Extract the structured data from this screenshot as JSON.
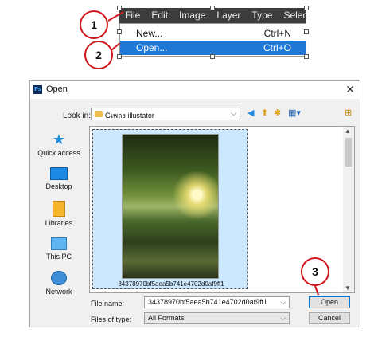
{
  "menubar": {
    "items": [
      "File",
      "Edit",
      "Image",
      "Layer",
      "Type",
      "Select"
    ]
  },
  "file_menu": {
    "new_label": "New...",
    "new_shortcut": "Ctrl+N",
    "open_label": "Open...",
    "open_shortcut": "Ctrl+O"
  },
  "steps": [
    "1",
    "2",
    "3"
  ],
  "dialog": {
    "app_badge": "Ps",
    "title": "Open",
    "close_glyph": "✕",
    "look_in_label": "Look in:",
    "look_in_value": "Ġเพลง illustator",
    "places": [
      "Quick access",
      "Desktop",
      "Libraries",
      "This PC",
      "Network"
    ],
    "file_item_name": "34378970bf5aea5b741e4702d0af9ff1",
    "file_name_label": "File name:",
    "file_name_value": "34378970bf5aea5b741e4702d0af9ff1",
    "file_type_label": "Files of type:",
    "file_type_value": "All Formats",
    "open_button": "Open",
    "cancel_button": "Cancel"
  },
  "colors": {
    "menu_bg": "#3c3c3c",
    "highlight": "#1f78d6",
    "callout": "#d0161c",
    "selection": "#cce8ff"
  }
}
